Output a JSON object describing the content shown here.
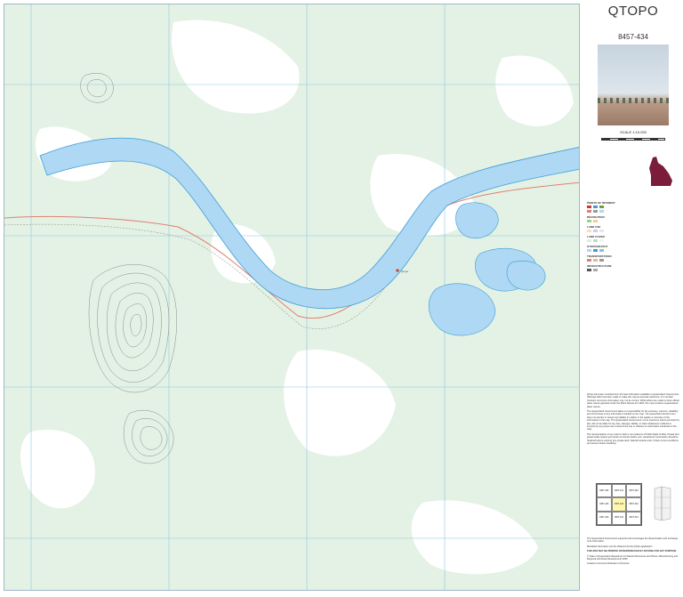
{
  "map": {
    "place_label": "Qtopo",
    "bottom_note": "",
    "colors": {
      "water": "#aed8f3",
      "water_edge": "#3f9dd6",
      "veg_medium": "#dcefdf",
      "veg_light": "#eef7ef",
      "contour": "#8a8a8a",
      "grid": "#8ec5e6",
      "road": "#e08070",
      "track": "#9a9a9a"
    }
  },
  "panel": {
    "title": "QTOPO",
    "sheet_number": "8457-434",
    "scale": "SCALE 1:10,000",
    "legend_title": "POINTS OF INTEREST",
    "legend_sections": [
      "RECREATION",
      "LAND USE",
      "LAND COVER",
      "HYDROGRAPHY",
      "TRANSPORTATION",
      "INFRASTRUCTURE"
    ],
    "disclaimer_1": "QTopo has been compiled from the best information available to Queensland Government. Although effort has been made to make the map as accurate reference, it is not field checked, and some information may not be current. While efforts are made to show official place names gazetted under the Place Names Act 1994, this map contains unguaranteed place names.",
    "disclaimer_2": "The Queensland Government takes no responsibility for the accuracy, currency, reliability, and correctness of any information included on the map. The Queensland Government does not warrant or accept any liability in relation to the quality or accuracy of the information in the map. The Queensland Government, to the maximum extent permitted by law, will not be liable for any loss, damage, liability, or claim whatsoever suffered or incurred by any person as a result of the use or reliance on information contained in this map.",
    "disclaimer_3": "The representation of any road or track is not evidence of Public Right of Way. Private and gravel roads require permission of owners before use. Landowners' permission should be obtained before entering any private land. Natural hazards exist. Check current conditions and access before travelling.",
    "index_cells": [
      "8457-432",
      "8457-441",
      "8457-442",
      "8457-433",
      "8457-434",
      "8457-443",
      "8457-423",
      "8457-424",
      "8457-413"
    ],
    "footer_1": "The Queensland Government supports and encourages the dissemination and exchange of its information.",
    "footer_2": "Metadata information can be obtained via the QTopo application",
    "footer_3": "THIS MAP MAY BE PRINTED OR REPRODUCED BY ANYONE FOR ANY PURPOSE",
    "footer_4": "© State of Queensland (Department of Natural Resources and Mines, Manufacturing and Regional and Rural Development) 2025",
    "footer_5": "Creative Commons Attribution 4.0 licence"
  }
}
